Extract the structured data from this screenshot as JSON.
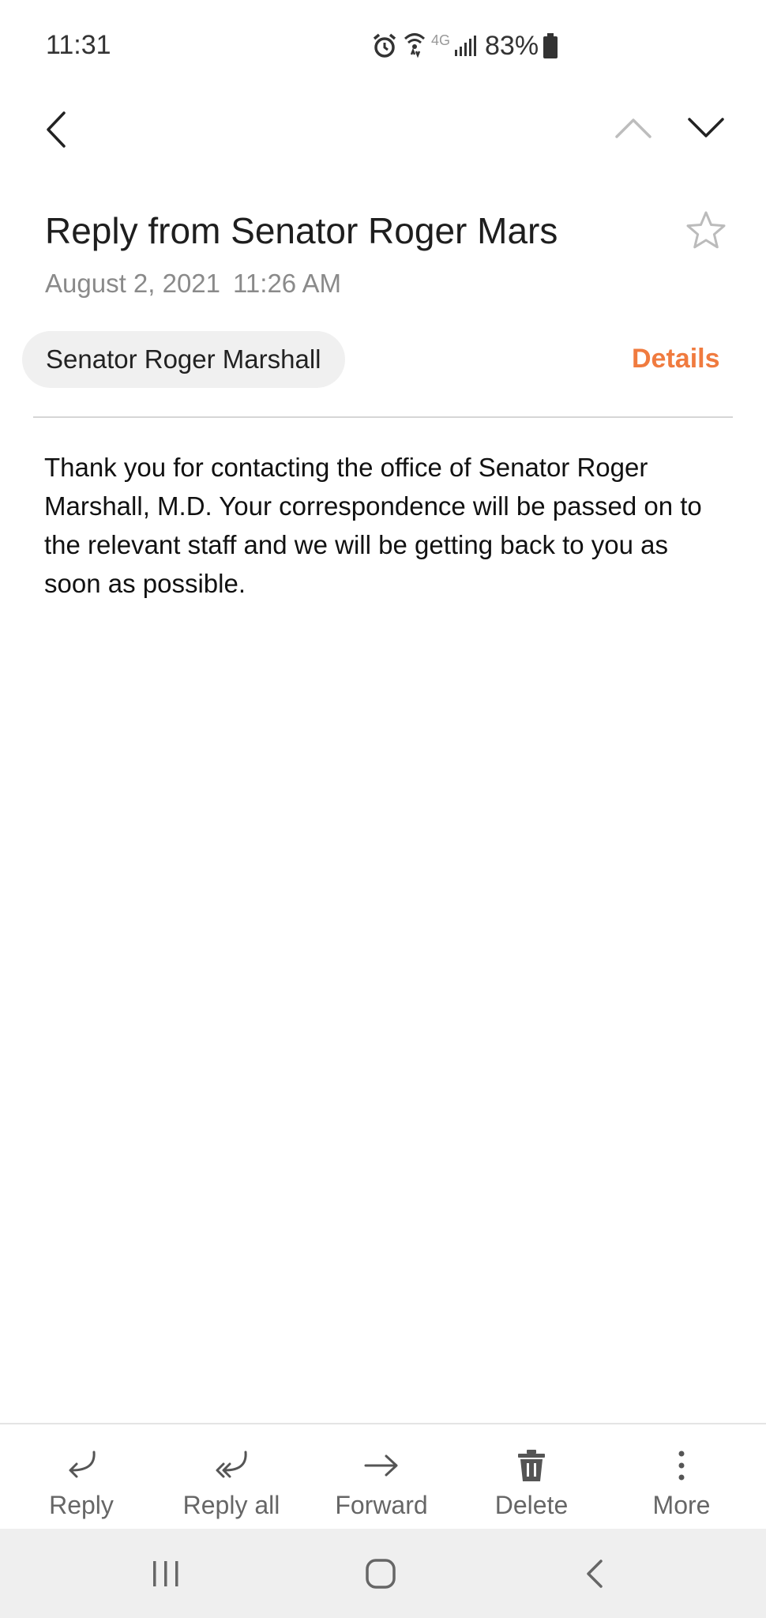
{
  "status_bar": {
    "time": "11:31",
    "network_label": "4G",
    "battery_percent": "83%",
    "icons": [
      "alarm-icon",
      "wifi-icon",
      "network-4g-icon",
      "signal-icon",
      "battery-icon"
    ]
  },
  "top_nav": {
    "icons": [
      "back-arrow-icon",
      "chevron-up-icon",
      "chevron-down-icon"
    ]
  },
  "email": {
    "subject": "Reply from Senator Roger Mars",
    "date": "August 2, 2021",
    "time": "11:26 AM",
    "sender": "Senator Roger Marshall",
    "details_label": "Details",
    "body": "Thank you for contacting the office of Senator Roger Marshall, M.D. Your correspondence will be passed on to the relevant staff and we will be getting back to you as soon as possible."
  },
  "actions": [
    {
      "label": "Reply",
      "icon": "reply-icon"
    },
    {
      "label": "Reply all",
      "icon": "reply-all-icon"
    },
    {
      "label": "Forward",
      "icon": "forward-icon"
    },
    {
      "label": "Delete",
      "icon": "trash-icon"
    },
    {
      "label": "More",
      "icon": "more-vertical-icon"
    }
  ],
  "colors": {
    "accent": "#f07b3f",
    "chip_background": "#f0f0f0",
    "nav_background": "#efefef"
  }
}
